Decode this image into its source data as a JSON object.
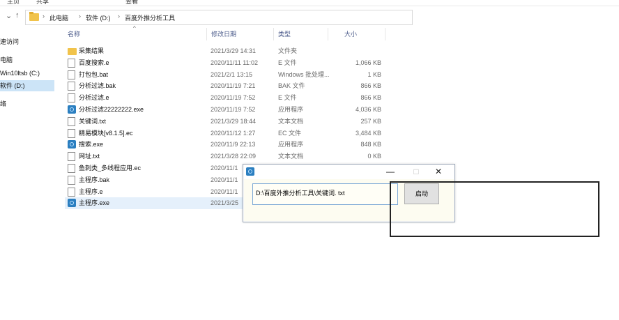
{
  "ribbon": {
    "tabs": [
      "主页",
      "共享",
      "查看"
    ]
  },
  "address_bar": {
    "crumbs": [
      "此电脑",
      "软件 (D:)",
      "百度外推分析工具"
    ]
  },
  "nav_pane": {
    "items": [
      {
        "label": "速访问"
      },
      {
        "label": "电脑"
      },
      {
        "label": "Win10ltsb (C:)"
      },
      {
        "label": "软件 (D:)"
      },
      {
        "label": "络"
      }
    ]
  },
  "columns": {
    "name": "名称",
    "date": "修改日期",
    "type": "类型",
    "size": "大小"
  },
  "files": [
    {
      "name": "采集结果",
      "date": "2021/3/29 14:31",
      "type": "文件夹",
      "size": "",
      "icon": "folder-icon"
    },
    {
      "name": "百度搜索.e",
      "date": "2020/11/11 11:02",
      "type": "E 文件",
      "size": "1,066 KB",
      "icon": "document-icon"
    },
    {
      "name": "打包包.bat",
      "date": "2021/2/1 13:15",
      "type": "Windows 批处理...",
      "size": "1 KB",
      "icon": "document-icon"
    },
    {
      "name": "分析过滤.bak",
      "date": "2020/11/19 7:21",
      "type": "BAK 文件",
      "size": "866 KB",
      "icon": "document-icon"
    },
    {
      "name": "分析过滤.e",
      "date": "2020/11/19 7:52",
      "type": "E 文件",
      "size": "866 KB",
      "icon": "document-icon"
    },
    {
      "name": "分析过滤22222222.exe",
      "date": "2020/11/19 7:52",
      "type": "应用程序",
      "size": "4,036 KB",
      "icon": "exe-icon"
    },
    {
      "name": "关键词.txt",
      "date": "2021/3/29 18:44",
      "type": "文本文档",
      "size": "257 KB",
      "icon": "document-icon"
    },
    {
      "name": "精易模块[v8.1.5].ec",
      "date": "2020/11/12 1:27",
      "type": "EC 文件",
      "size": "3,484 KB",
      "icon": "document-icon"
    },
    {
      "name": "搜索.exe",
      "date": "2020/11/9 22:13",
      "type": "应用程序",
      "size": "848 KB",
      "icon": "exe-icon"
    },
    {
      "name": "网址.txt",
      "date": "2021/3/28 22:09",
      "type": "文本文档",
      "size": "0 KB",
      "icon": "document-icon"
    },
    {
      "name": "鱼刺类_多线程应用.ec",
      "date": "2020/11/1",
      "type": "",
      "size": "",
      "icon": "document-icon"
    },
    {
      "name": "主程序.bak",
      "date": "2020/11/1",
      "type": "",
      "size": "",
      "icon": "document-icon"
    },
    {
      "name": "主程序.e",
      "date": "2020/11/1",
      "type": "",
      "size": "",
      "icon": "document-icon"
    },
    {
      "name": "主程序.exe",
      "date": "2021/3/25",
      "type": "",
      "size": "",
      "icon": "exe-icon"
    }
  ],
  "app_window": {
    "minimize": "—",
    "maximize": "□",
    "close": "✕",
    "path_value": "D:\\百度外推分析工具\\关键词. txt",
    "start_label": "启动"
  }
}
